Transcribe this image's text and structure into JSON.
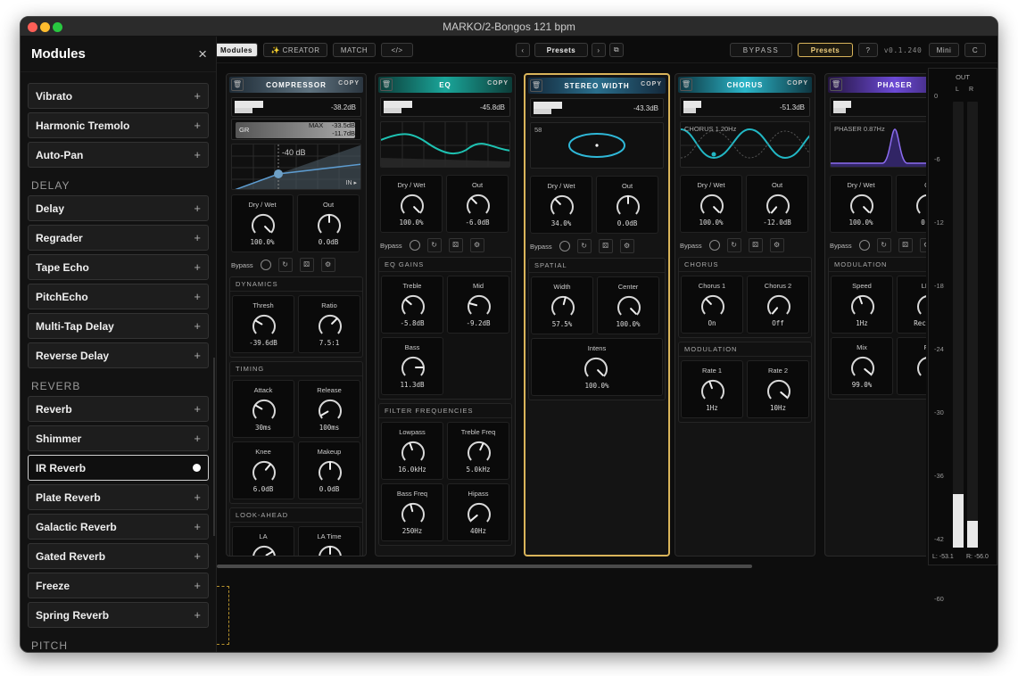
{
  "window": {
    "title": "MARKO/2-Bongos 121 bpm"
  },
  "sidebar": {
    "title": "Modules",
    "close_icon": "×",
    "items_top": [
      {
        "label": "Vibrato",
        "plus": "+"
      },
      {
        "label": "Harmonic Tremolo",
        "plus": "+"
      },
      {
        "label": "Auto-Pan",
        "plus": "+"
      }
    ],
    "section_delay": "DELAY",
    "items_delay": [
      {
        "label": "Delay",
        "plus": "+"
      },
      {
        "label": "Regrader",
        "plus": "+"
      },
      {
        "label": "Tape Echo",
        "plus": "+"
      },
      {
        "label": "PitchEcho",
        "plus": "+"
      },
      {
        "label": "Multi-Tap Delay",
        "plus": "+"
      },
      {
        "label": "Reverse Delay",
        "plus": "+"
      }
    ],
    "section_reverb": "REVERB",
    "items_reverb": [
      {
        "label": "Reverb",
        "plus": "+"
      },
      {
        "label": "Shimmer",
        "plus": "+"
      },
      {
        "label": "IR Reverb",
        "plus": "+"
      },
      {
        "label": "Plate Reverb",
        "plus": "+"
      },
      {
        "label": "Galactic Reverb",
        "plus": "+"
      },
      {
        "label": "Gated Reverb",
        "plus": "+"
      },
      {
        "label": "Freeze",
        "plus": "+"
      },
      {
        "label": "Spring Reverb",
        "plus": "+"
      }
    ],
    "section_pitch": "PITCH"
  },
  "toolbar": {
    "modules": "Modules",
    "creator": "✨ CREATOR",
    "match": "MATCH",
    "code": "</>",
    "prev": "‹",
    "presets_center": "Presets",
    "next": "›",
    "duplicate": "⧉",
    "bypass": "BYPASS",
    "presets_right": "Presets",
    "help": "?",
    "version": "v0.1.240",
    "mini": "Mini",
    "c": "C"
  },
  "common": {
    "trash": "🗑",
    "copy": "COPY",
    "bypass": "Bypass",
    "refresh": "↻",
    "random": "⚄",
    "gear": "⚙"
  },
  "compressor": {
    "name": "COMPRESSOR",
    "level": "-38.2dB",
    "gr": "GR",
    "max": "MAX",
    "gr_v1": "-33.5dB",
    "gr_v2": "-11.7dB",
    "thresh_label": "-40 dB",
    "in_label": "IN ▸",
    "drywet": {
      "label": "Dry / Wet",
      "value": "100.0%"
    },
    "out": {
      "label": "Out",
      "value": "0.0dB"
    },
    "dynamics": "DYNAMICS",
    "thresh": {
      "label": "Thresh",
      "value": "-39.6dB"
    },
    "ratio": {
      "label": "Ratio",
      "value": "7.5:1"
    },
    "timing": "TIMING",
    "attack": {
      "label": "Attack",
      "value": "30ms"
    },
    "release": {
      "label": "Release",
      "value": "100ms"
    },
    "knee": {
      "label": "Knee",
      "value": "6.0dB"
    },
    "makeup": {
      "label": "Makeup",
      "value": "0.0dB"
    },
    "lookahead": "LOOK-AHEAD",
    "la": {
      "label": "LA"
    },
    "latime": {
      "label": "LA Time"
    }
  },
  "eq": {
    "name": "EQ",
    "level": "-45.8dB",
    "drywet": {
      "label": "Dry / Wet",
      "value": "100.0%"
    },
    "out": {
      "label": "Out",
      "value": "-6.0dB"
    },
    "gains": "EQ GAINS",
    "treble": {
      "label": "Treble",
      "value": "-5.8dB"
    },
    "mid": {
      "label": "Mid",
      "value": "-9.2dB"
    },
    "bass": {
      "label": "Bass",
      "value": "11.3dB"
    },
    "filters": "FILTER FREQUENCIES",
    "lowpass": {
      "label": "Lowpass",
      "value": "16.0kHz"
    },
    "treblefreq": {
      "label": "Treble Freq",
      "value": "5.0kHz"
    },
    "bassfreq": {
      "label": "Bass Freq",
      "value": "250Hz"
    },
    "hipass": {
      "label": "Hipass",
      "value": "40Hz"
    }
  },
  "stereo": {
    "name": "STEREO WIDTH",
    "level": "-43.3dB",
    "viz_value": "58",
    "drywet": {
      "label": "Dry / Wet",
      "value": "34.0%"
    },
    "out": {
      "label": "Out",
      "value": "0.0dB"
    },
    "spatial": "SPATIAL",
    "width": {
      "label": "Width",
      "value": "57.5%"
    },
    "center": {
      "label": "Center",
      "value": "100.0%"
    },
    "intens": {
      "label": "Intens",
      "value": "100.0%"
    }
  },
  "chorus": {
    "name": "CHORUS",
    "level": "-51.3dB",
    "viz_label": "CHORUS 1.20Hz",
    "drywet": {
      "label": "Dry / Wet",
      "value": "100.0%"
    },
    "out": {
      "label": "Out",
      "value": "-12.0dB"
    },
    "chorus_section": "CHORUS",
    "c1": {
      "label": "Chorus 1",
      "value": "On"
    },
    "c2": {
      "label": "Chorus 2",
      "value": "Off"
    },
    "modulation": "MODULATION",
    "r1": {
      "label": "Rate 1",
      "value": "1Hz"
    },
    "r2": {
      "label": "Rate 2",
      "value": "10Hz"
    }
  },
  "phaser": {
    "name": "PHASER",
    "viz_label": "PHASER 0.87Hz",
    "drywet": {
      "label": "Dry / Wet",
      "value": "100.0%"
    },
    "out": {
      "label": "O",
      "value": "0.0"
    },
    "modulation": "MODULATION",
    "speed": {
      "label": "Speed",
      "value": "1Hz"
    },
    "lfo": {
      "label": "LFO",
      "value": "Rectifi"
    },
    "mix": {
      "label": "Mix",
      "value": "99.0%"
    },
    "fe": {
      "label": "Fe",
      "value": "0"
    }
  },
  "meter": {
    "title": "OUT",
    "l": "L",
    "r": "R",
    "ticks": [
      "0",
      "-6",
      "-12",
      "-18",
      "-24",
      "-30",
      "-36",
      "-42",
      "-60"
    ],
    "l_readout": "L: -53.1",
    "r_readout": "R: -56.0",
    "l_level": 0.12,
    "r_level": 0.06
  },
  "colors": {
    "accent": "#d9b45a",
    "eq": "#1aa69a",
    "chorus": "#2bb6c9",
    "phaser": "#6c4ad6",
    "stereo": "#2a6f8d"
  }
}
